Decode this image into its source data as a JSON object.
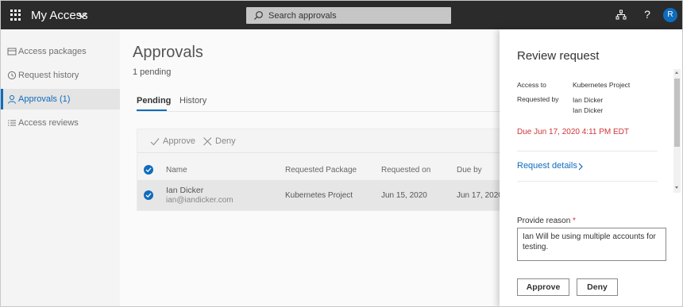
{
  "header": {
    "app_title": "My Access",
    "search_placeholder": "Search approvals",
    "avatar_initial": "R",
    "help_label": "?"
  },
  "sidebar": {
    "items": [
      {
        "label": "Access packages",
        "icon": "package-icon",
        "active": false
      },
      {
        "label": "Request history",
        "icon": "history-icon",
        "active": false
      },
      {
        "label": "Approvals (1)",
        "icon": "person-icon",
        "active": true
      },
      {
        "label": "Access reviews",
        "icon": "list-icon",
        "active": false
      }
    ]
  },
  "main": {
    "title": "Approvals",
    "subtitle": "1 pending",
    "tabs": [
      {
        "label": "Pending",
        "active": true
      },
      {
        "label": "History",
        "active": false
      }
    ],
    "commands": {
      "approve": "Approve",
      "deny": "Deny"
    },
    "columns": [
      "Name",
      "Requested Package",
      "Requested on",
      "Due by"
    ],
    "rows": [
      {
        "name": "Ian Dicker",
        "email": "ian@iandicker.com",
        "package": "Kubernetes Project",
        "requested_on": "Jun 15, 2020",
        "due_by": "Jun 17, 2020"
      }
    ]
  },
  "panel": {
    "title": "Review request",
    "access_to_label": "Access to",
    "access_to_value": "Kubernetes Project",
    "requested_by_label": "Requested by",
    "requested_by_value": "Ian Dicker",
    "requested_by_value2": "Ian Dicker",
    "due": "Due Jun 17, 2020 4:11 PM EDT",
    "request_details": "Request details",
    "reason_label": "Provide reason",
    "reason_required_mark": "*",
    "reason_value": "Ian Will be using multiple accounts for testing.",
    "approve_label": "Approve",
    "deny_label": "Deny"
  },
  "colors": {
    "topbar": "#2b2b2b",
    "accent": "#0f6cbd",
    "due_text": "#d13438"
  }
}
